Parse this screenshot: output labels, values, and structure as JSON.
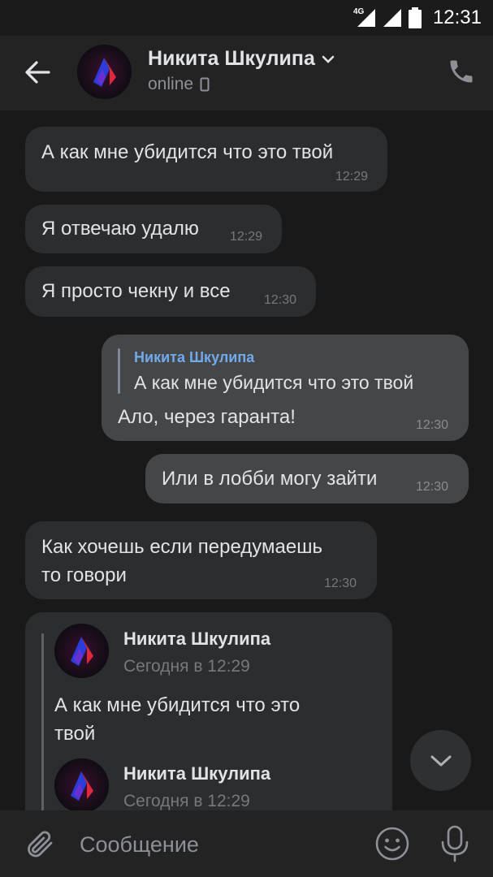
{
  "status_bar": {
    "network": "4G",
    "time": "12:31"
  },
  "header": {
    "contact_name": "Никита Шкулипа",
    "status": "online"
  },
  "messages": [
    {
      "text": "А как мне убидится что это твой",
      "time": "12:29",
      "direction": "in"
    },
    {
      "text": "Я отвечаю удалю",
      "time": "12:29",
      "direction": "in"
    },
    {
      "text": "Я просто чекну и все",
      "time": "12:30",
      "direction": "in"
    },
    {
      "direction": "out",
      "reply_to": {
        "author": "Никита Шкулипа",
        "text": "А как мне убидится что это твой"
      },
      "text": "Ало, через гаранта!",
      "time": "12:30"
    },
    {
      "text": "Или в лобби могу зайти",
      "time": "12:30",
      "direction": "out"
    },
    {
      "lines": [
        "Как хочешь если передумаешь",
        "то говори"
      ],
      "time": "12:30",
      "direction": "in"
    },
    {
      "direction": "in",
      "forwarded": [
        {
          "author": "Никита Шкулипа",
          "time": "Сегодня в 12:29",
          "lines": [
            "А как мне убидится что это",
            "твой"
          ]
        },
        {
          "author": "Никита Шкулипа",
          "time": "Сегодня в 12:29"
        }
      ]
    }
  ],
  "composer": {
    "placeholder": "Сообщение"
  },
  "colors": {
    "background": "#19191a",
    "bubble_in": "#2c2d2e",
    "bubble_out": "#454647",
    "accent": "#71aaeb"
  },
  "icons": [
    "back-arrow-icon",
    "chevron-down-icon",
    "phone-icon",
    "mobile-device-icon",
    "paperclip-icon",
    "smile-icon",
    "microphone-icon",
    "chevron-down-icon"
  ]
}
